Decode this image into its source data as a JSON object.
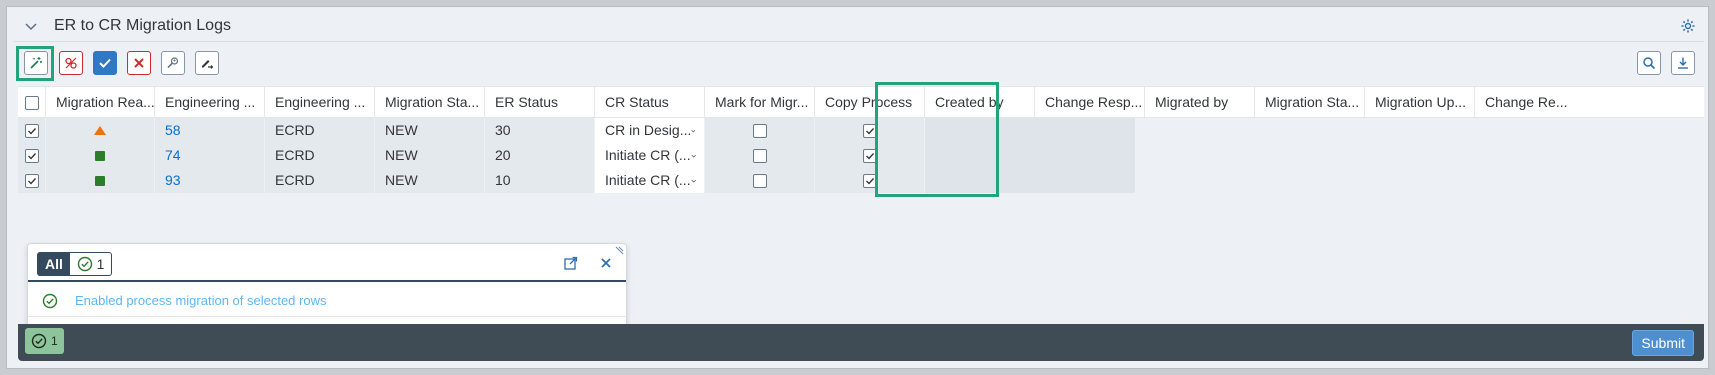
{
  "panel": {
    "title": "ER to CR Migration Logs"
  },
  "table": {
    "columns": [
      "Migration Rea...",
      "Engineering ...",
      "Engineering ...",
      "Migration Sta...",
      "ER Status",
      "CR Status",
      "Mark for Migr...",
      "Copy Process",
      "Created by",
      "Change Resp...",
      "Migrated by",
      "Migration Sta...",
      "Migration Up...",
      "Change Re..."
    ],
    "rows": [
      {
        "readiness": "warning",
        "eng_id": "58",
        "eng_type": "ECRD",
        "migration_status": "NEW",
        "er_status": "30",
        "cr_status": "CR in Desig...",
        "mark": false,
        "copy": true
      },
      {
        "readiness": "success",
        "eng_id": "74",
        "eng_type": "ECRD",
        "migration_status": "NEW",
        "er_status": "20",
        "cr_status": "Initiate CR (...",
        "mark": false,
        "copy": true
      },
      {
        "readiness": "success",
        "eng_id": "93",
        "eng_type": "ECRD",
        "migration_status": "NEW",
        "er_status": "10",
        "cr_status": "Initiate CR (...",
        "mark": false,
        "copy": true
      }
    ]
  },
  "messages": {
    "filter_all": "All",
    "success_count": "1",
    "items": [
      "Enabled process migration of selected rows"
    ]
  },
  "footer": {
    "message_count": "1",
    "submit_label": "Submit"
  },
  "colors": {
    "highlight": "#22a37a",
    "link": "#0a6ed1",
    "warning": "#e9730c",
    "success": "#2b7d2b",
    "footer_bg": "#3f4b55"
  }
}
